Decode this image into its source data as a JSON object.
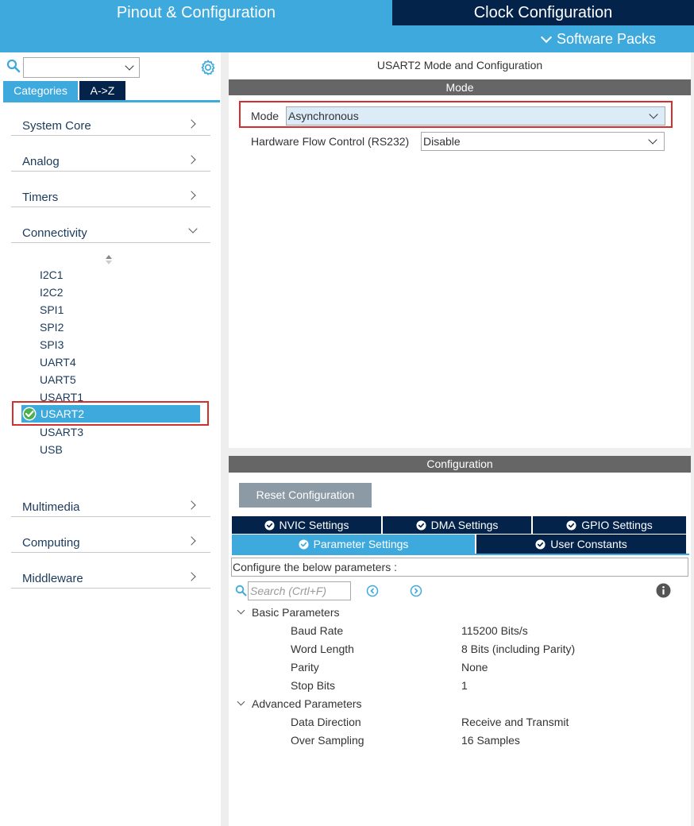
{
  "header": {
    "tab_pinout": "Pinout & Configuration",
    "tab_clock": "Clock Configuration",
    "software_packs": "Software Packs"
  },
  "sidebar": {
    "search_value": "",
    "tabs": [
      "Categories",
      "A->Z"
    ],
    "categories": [
      "System Core",
      "Analog",
      "Timers",
      "Connectivity",
      "Multimedia",
      "Computing",
      "Middleware"
    ],
    "connectivity_items": [
      "I2C1",
      "I2C2",
      "SPI1",
      "SPI2",
      "SPI3",
      "UART4",
      "UART5",
      "USART1",
      "USART2",
      "USART3",
      "USB"
    ],
    "selected_item": "USART2"
  },
  "mode_panel": {
    "title": "USART2 Mode and Configuration",
    "section": "Mode",
    "mode_label": "Mode",
    "mode_value": "Asynchronous",
    "hfc_label": "Hardware Flow Control (RS232)",
    "hfc_value": "Disable"
  },
  "config_panel": {
    "section": "Configuration",
    "reset_button": "Reset Configuration",
    "tabs_row1": [
      "NVIC Settings",
      "DMA Settings",
      "GPIO Settings"
    ],
    "tabs_row2": [
      "Parameter Settings",
      "User Constants"
    ],
    "active_tab": "Parameter Settings",
    "configure_text": "Configure the below parameters :",
    "search_placeholder": "Search (Crtl+F)",
    "groups": [
      {
        "name": "Basic Parameters",
        "params": [
          {
            "name": "Baud Rate",
            "value": "115200 Bits/s"
          },
          {
            "name": "Word Length",
            "value": "8 Bits (including Parity)"
          },
          {
            "name": "Parity",
            "value": "None"
          },
          {
            "name": "Stop Bits",
            "value": "1"
          }
        ]
      },
      {
        "name": "Advanced Parameters",
        "params": [
          {
            "name": "Data Direction",
            "value": "Receive and Transmit"
          },
          {
            "name": "Over Sampling",
            "value": "16 Samples"
          }
        ]
      }
    ]
  },
  "colors": {
    "accent_blue": "#3da9dd",
    "dark_navy": "#03234b",
    "section_gray": "#666666",
    "highlight_red": "#d32f2f"
  }
}
